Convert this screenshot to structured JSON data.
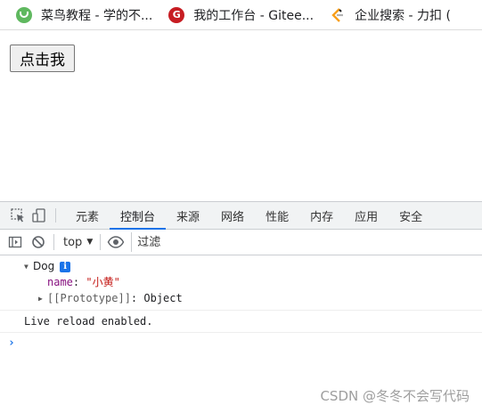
{
  "bookmarks": [
    {
      "label": "菜鸟教程 - 学的不...",
      "icon": "runoob-icon"
    },
    {
      "label": "我的工作台 - Gitee...",
      "icon": "gitee-icon"
    },
    {
      "label": "企业搜索 - 力扣 (",
      "icon": "leetcode-icon"
    }
  ],
  "page": {
    "button_label": "点击我"
  },
  "devtools": {
    "tabs": [
      "元素",
      "控制台",
      "来源",
      "网络",
      "性能",
      "内存",
      "应用",
      "安全"
    ],
    "active_tab": "控制台",
    "console": {
      "context": "top",
      "filter_placeholder": "过滤",
      "object": {
        "class_name": "Dog",
        "info_badge": "i",
        "prop_key": "name",
        "prop_value": "\"小黄\"",
        "proto_label": "[[Prototype]]",
        "proto_value": "Object"
      },
      "log_message": "Live reload enabled.",
      "prompt": "›"
    }
  },
  "watermark": "CSDN @冬冬不会写代码",
  "colors": {
    "accent": "#1a73e8",
    "key": "#881280",
    "string": "#c41a16"
  }
}
